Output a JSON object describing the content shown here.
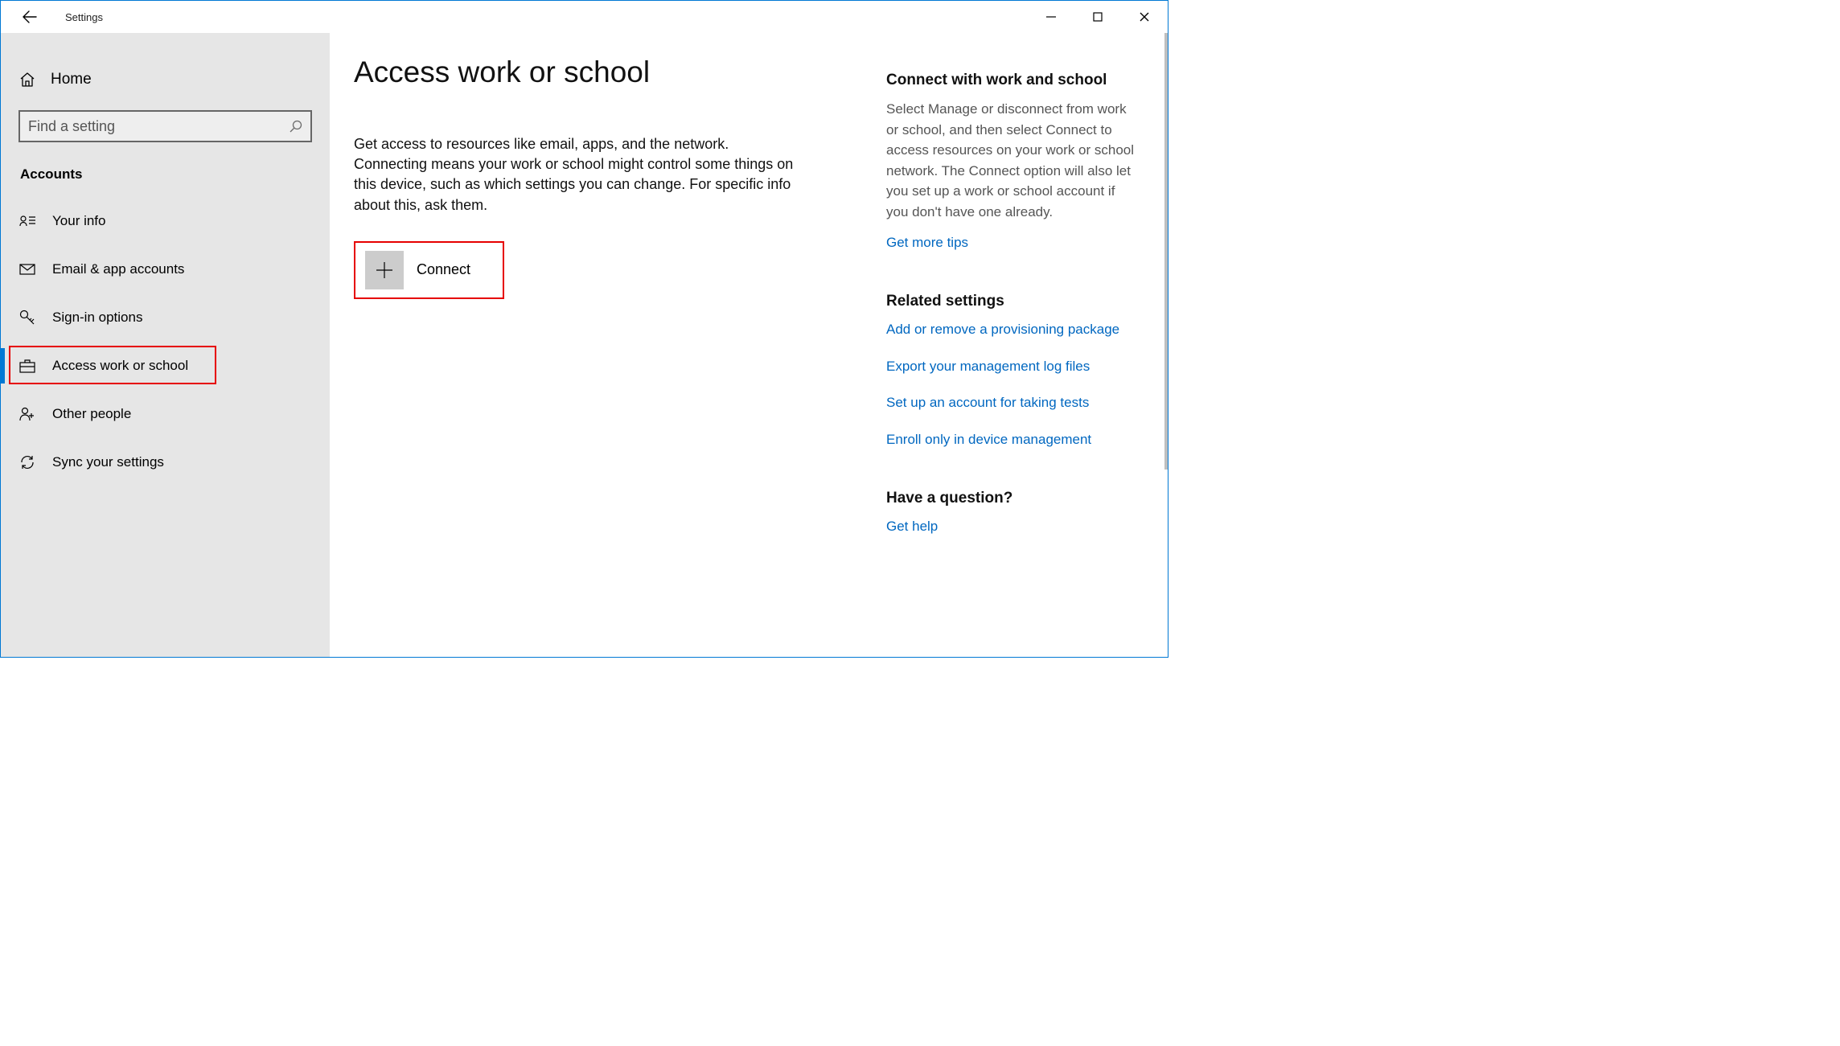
{
  "titlebar": {
    "label": "Settings"
  },
  "sidebar": {
    "home": "Home",
    "search_placeholder": "Find a setting",
    "section": "Accounts",
    "items": [
      {
        "label": "Your info"
      },
      {
        "label": "Email & app accounts"
      },
      {
        "label": "Sign-in options"
      },
      {
        "label": "Access work or school"
      },
      {
        "label": "Other people"
      },
      {
        "label": "Sync your settings"
      }
    ]
  },
  "page": {
    "title": "Access work or school",
    "description": "Get access to resources like email, apps, and the network. Connecting means your work or school might control some things on this device, such as which settings you can change. For specific info about this, ask them.",
    "connect_label": "Connect"
  },
  "aside": {
    "connect": {
      "title": "Connect with work and school",
      "text": "Select Manage or disconnect from work or school, and then select Connect to access resources on your work or school network. The Connect option will also let you set up a work or school account if you don't have one already.",
      "link": "Get more tips"
    },
    "related": {
      "title": "Related settings",
      "links": [
        "Add or remove a provisioning package",
        "Export your management log files",
        "Set up an account for taking tests",
        "Enroll only in device management"
      ]
    },
    "question": {
      "title": "Have a question?",
      "link": "Get help"
    }
  }
}
